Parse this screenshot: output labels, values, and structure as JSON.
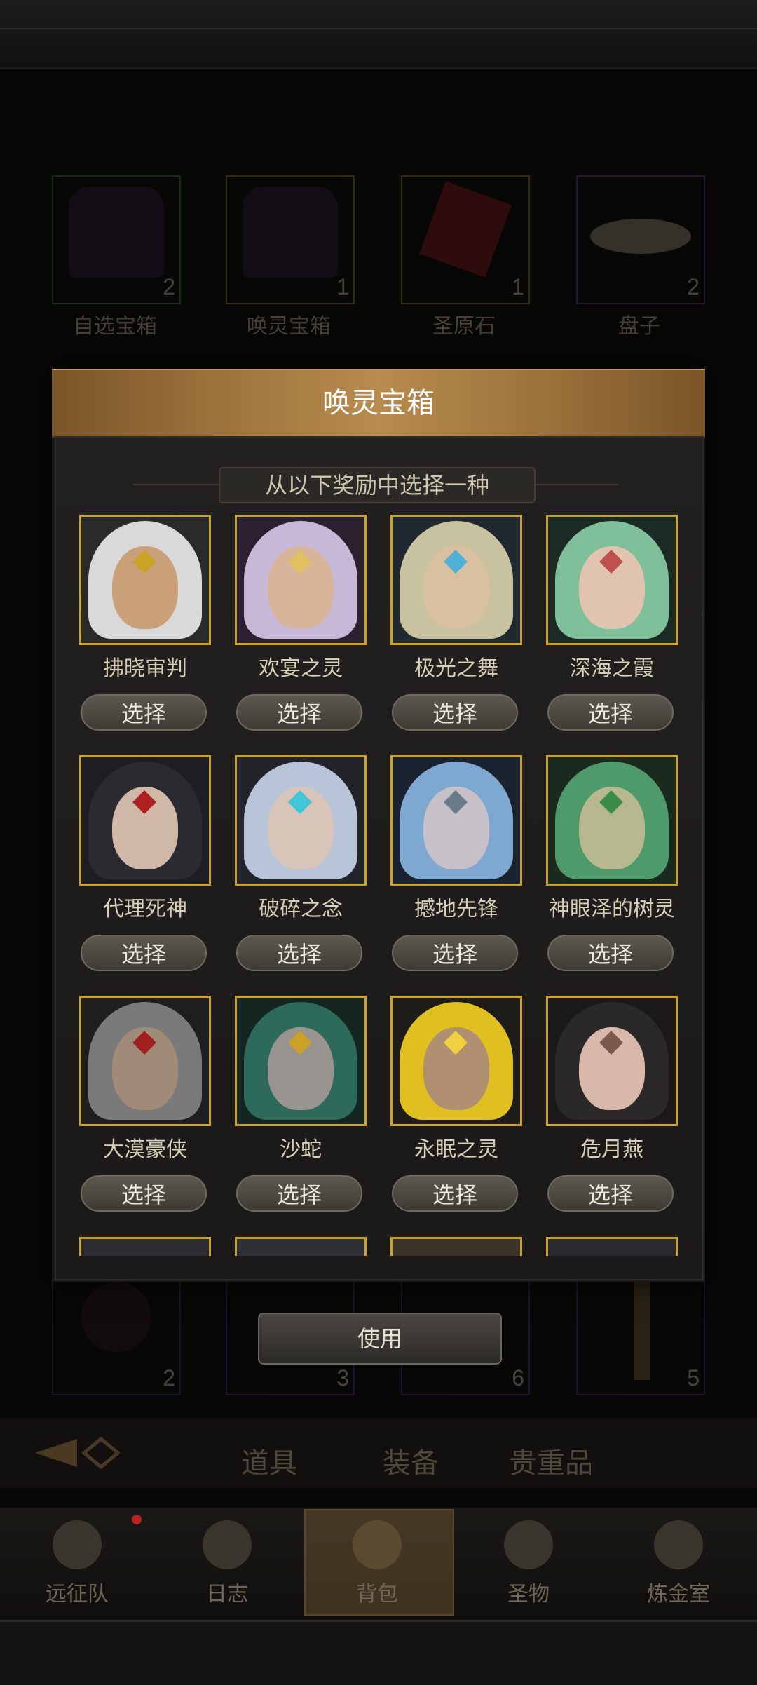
{
  "inventory_top": [
    {
      "name": "自选宝箱",
      "count": "2",
      "border": "#3b7a2a",
      "icon": "treasure-chest-icon"
    },
    {
      "name": "唤灵宝箱",
      "count": "1",
      "border": "#8a6a2a",
      "icon": "treasure-chest-icon"
    },
    {
      "name": "圣原石",
      "count": "1",
      "border": "#8a6a2a",
      "icon": "red-gem-icon"
    },
    {
      "name": "盘子",
      "count": "2",
      "border": "#5a3a8a",
      "icon": "plate-icon"
    }
  ],
  "inventory_bottom_counts": [
    "2",
    "3",
    "6",
    "5"
  ],
  "dialog": {
    "title": "唤灵宝箱",
    "subtitle": "从以下奖励中选择一种",
    "select_label": "选择",
    "heroes": [
      {
        "name": "拂晓审判"
      },
      {
        "name": "欢宴之灵"
      },
      {
        "name": "极光之舞"
      },
      {
        "name": "深海之霞"
      },
      {
        "name": "代理死神"
      },
      {
        "name": "破碎之念"
      },
      {
        "name": "撼地先锋"
      },
      {
        "name": "神眼泽的树灵"
      },
      {
        "name": "大漠豪侠"
      },
      {
        "name": "沙蛇"
      },
      {
        "name": "永眠之灵"
      },
      {
        "name": "危月燕"
      }
    ]
  },
  "use_button": "使用",
  "tabs": [
    "道具",
    "装备",
    "贵重品"
  ],
  "nav": [
    "远征队",
    "日志",
    "背包",
    "圣物",
    "炼金室"
  ],
  "colors": {
    "accent_gold": "#c9a227",
    "header_gold": "#a2783f"
  }
}
